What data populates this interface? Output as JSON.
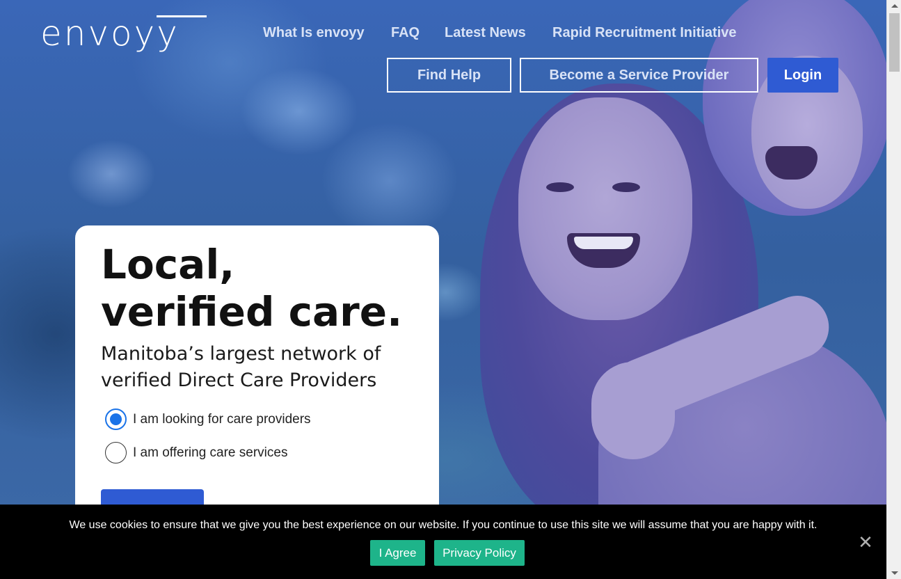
{
  "brand": {
    "logo_text": "envoyy"
  },
  "nav": {
    "links": [
      "What Is envoyy",
      "FAQ",
      "Latest News",
      "Rapid Recruitment Initiative"
    ],
    "find_help": "Find Help",
    "become_provider": "Become a Service Provider",
    "login": "Login"
  },
  "hero": {
    "title": "Local, verified care.",
    "subtitle": "Manitoba’s largest network of verified Direct Care Providers",
    "options": [
      {
        "label": "I am looking for care providers",
        "selected": true
      },
      {
        "label": "I am offering care services",
        "selected": false
      }
    ]
  },
  "cookie": {
    "message": "We use cookies to ensure that we give you the best experience on our website. If you continue to use this site we will assume that you are happy with it.",
    "agree": "I Agree",
    "privacy": "Privacy Policy",
    "close_icon": "close-icon"
  },
  "colors": {
    "primary_button": "#2f5bd3",
    "cookie_button": "#1eb48a",
    "radio_selected": "#1a73e8",
    "overlay": "#3a67b8"
  }
}
